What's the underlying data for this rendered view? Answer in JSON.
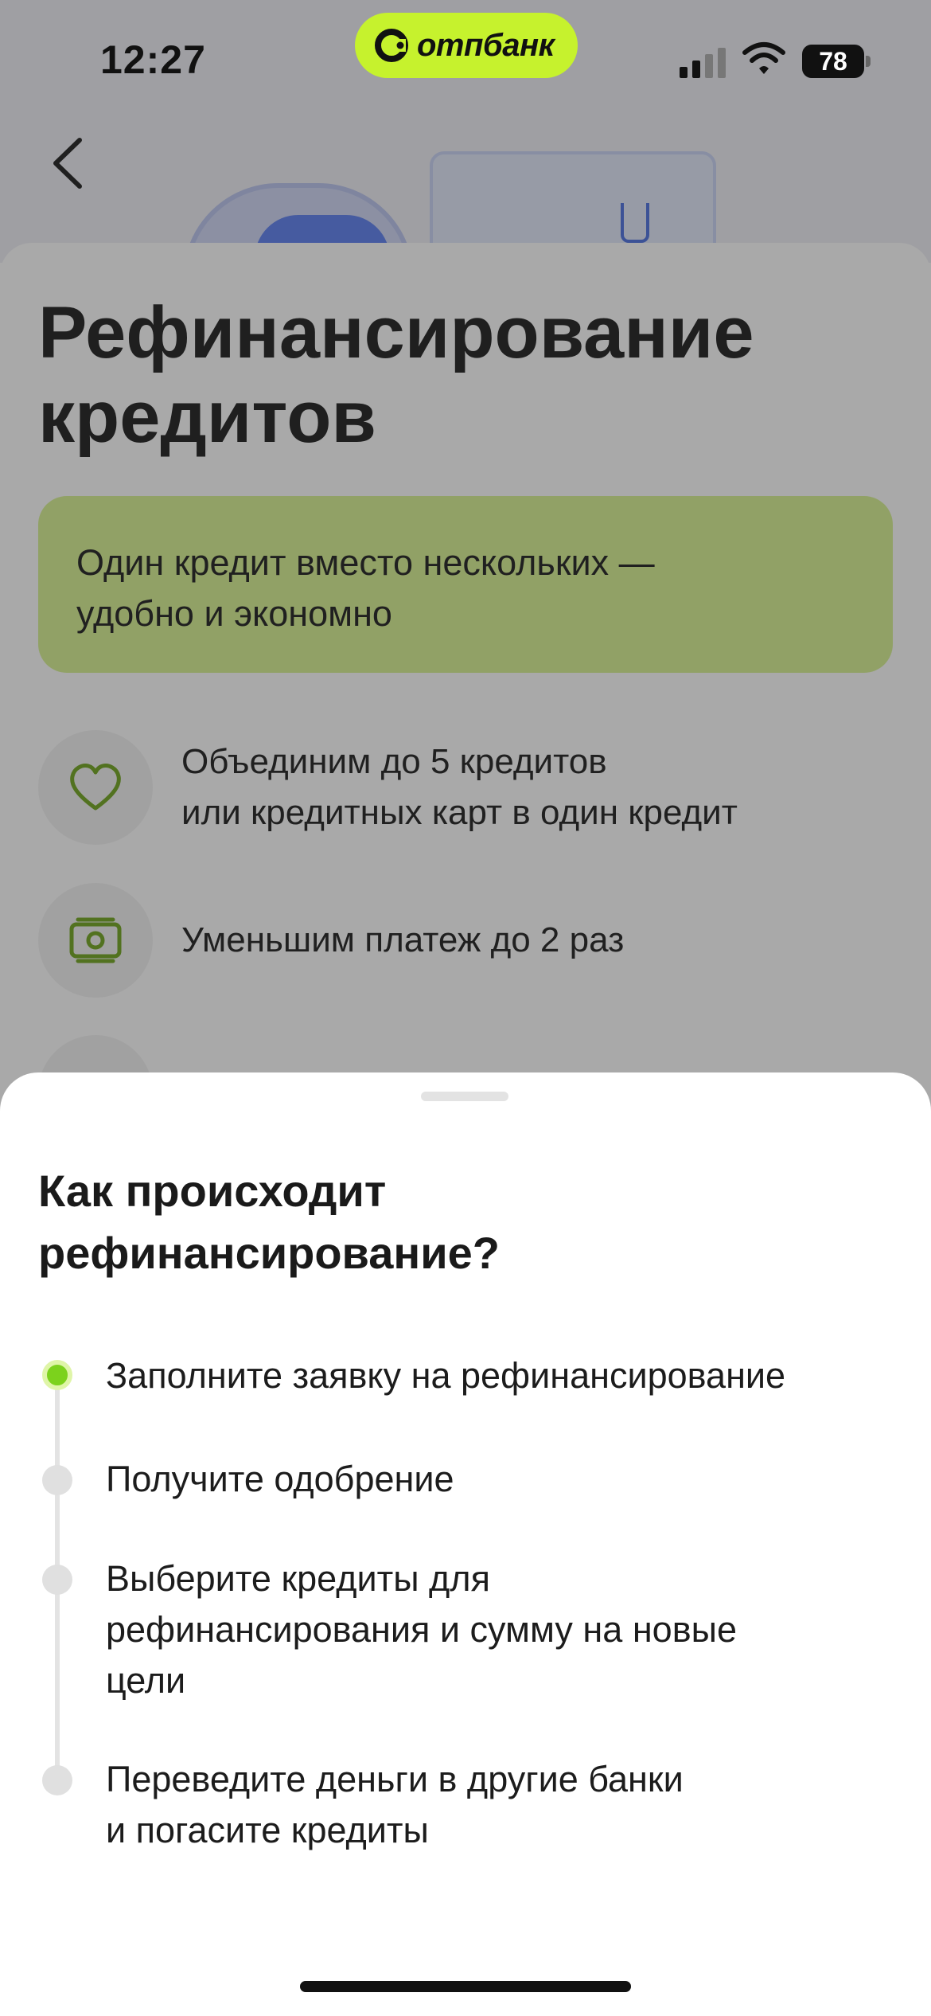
{
  "status_bar": {
    "time": "12:27",
    "bank_name": "отпбанк",
    "battery": "78"
  },
  "page": {
    "title_lines": [
      "Рефинансирование",
      "кредитов"
    ],
    "banner_lines": [
      "Один кредит вместо нескольких —",
      "удобно и экономно"
    ],
    "features": [
      {
        "icon": "heart-icon",
        "lines": [
          "Объединим до 5 кредитов",
          "или кредитных карт в один кредит"
        ]
      },
      {
        "icon": "money-icon",
        "lines": [
          "Уменьшим платеж до 2 раз"
        ]
      }
    ]
  },
  "sheet": {
    "title_lines": [
      "Как происходит",
      "рефинансирование?"
    ],
    "steps": [
      {
        "lines": [
          "Заполните заявку на рефинансирование"
        ],
        "active": true
      },
      {
        "lines": [
          "Получите одобрение"
        ],
        "active": false
      },
      {
        "lines": [
          "Выберите кредиты для",
          "рефинансирования и сумму на новые",
          "цели"
        ],
        "active": false
      },
      {
        "lines": [
          "Переведите деньги в другие банки",
          "и погасите кредиты"
        ],
        "active": false
      }
    ]
  },
  "colors": {
    "accent_green": "#c6f22d",
    "active_dot": "#7cd21c",
    "banner_bg": "#d7f28f",
    "icon_green": "#6ea31c"
  }
}
